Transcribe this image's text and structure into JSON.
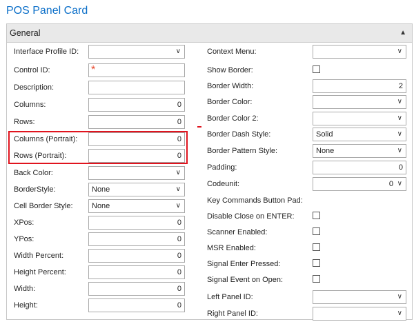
{
  "page": {
    "title": "POS Panel Card"
  },
  "section": {
    "title": "General"
  },
  "left_fields": [
    {
      "label": "Interface Profile ID:",
      "type": "dropdown",
      "value": ""
    },
    {
      "label": "Control ID:",
      "type": "text-required",
      "value": "*"
    },
    {
      "label": "Description:",
      "type": "text",
      "value": ""
    },
    {
      "label": "Columns:",
      "type": "number",
      "value": "0"
    },
    {
      "label": "Rows:",
      "type": "number",
      "value": "0"
    },
    {
      "label": "Columns (Portrait):",
      "type": "number",
      "value": "0"
    },
    {
      "label": "Rows (Portrait):",
      "type": "number",
      "value": "0"
    },
    {
      "label": "Back Color:",
      "type": "dropdown",
      "value": ""
    },
    {
      "label": "BorderStyle:",
      "type": "dropdown",
      "value": "None"
    },
    {
      "label": "Cell Border Style:",
      "type": "dropdown",
      "value": "None"
    },
    {
      "label": "XPos:",
      "type": "number",
      "value": "0"
    },
    {
      "label": "YPos:",
      "type": "number",
      "value": "0"
    },
    {
      "label": "Width Percent:",
      "type": "number",
      "value": "0"
    },
    {
      "label": "Height Percent:",
      "type": "number",
      "value": "0"
    },
    {
      "label": "Width:",
      "type": "number",
      "value": "0"
    },
    {
      "label": "Height:",
      "type": "number",
      "value": "0"
    }
  ],
  "right_fields": [
    {
      "label": "Context Menu:",
      "type": "dropdown",
      "value": ""
    },
    {
      "label": "Show Border:",
      "type": "checkbox",
      "value": ""
    },
    {
      "label": "Border Width:",
      "type": "number",
      "value": "2"
    },
    {
      "label": "Border Color:",
      "type": "dropdown",
      "value": ""
    },
    {
      "label": "Border Color 2:",
      "type": "dropdown",
      "value": ""
    },
    {
      "label": "Border Dash Style:",
      "type": "dropdown",
      "value": "Solid"
    },
    {
      "label": "Border Pattern Style:",
      "type": "dropdown",
      "value": "None"
    },
    {
      "label": "Padding:",
      "type": "number",
      "value": "0"
    },
    {
      "label": "Codeunit:",
      "type": "number-dropdown",
      "value": "0"
    },
    {
      "label": "Key Commands Button Pad:",
      "type": "label",
      "value": ""
    },
    {
      "label": "Disable Close on ENTER:",
      "type": "checkbox",
      "value": ""
    },
    {
      "label": "Scanner Enabled:",
      "type": "checkbox",
      "value": ""
    },
    {
      "label": "MSR Enabled:",
      "type": "checkbox",
      "value": ""
    },
    {
      "label": "Signal Enter Pressed:",
      "type": "checkbox",
      "value": ""
    },
    {
      "label": "Signal Event on Open:",
      "type": "checkbox",
      "value": ""
    },
    {
      "label": "Left Panel ID:",
      "type": "dropdown",
      "value": ""
    },
    {
      "label": "Right Panel ID:",
      "type": "dropdown",
      "value": ""
    }
  ],
  "colors": {
    "title": "#0a6ec8",
    "highlight": "#e0141e",
    "required": "#e8472b"
  },
  "icons": {
    "chevron": "chevron-down-icon",
    "collapse": "chevron-up-icon"
  }
}
